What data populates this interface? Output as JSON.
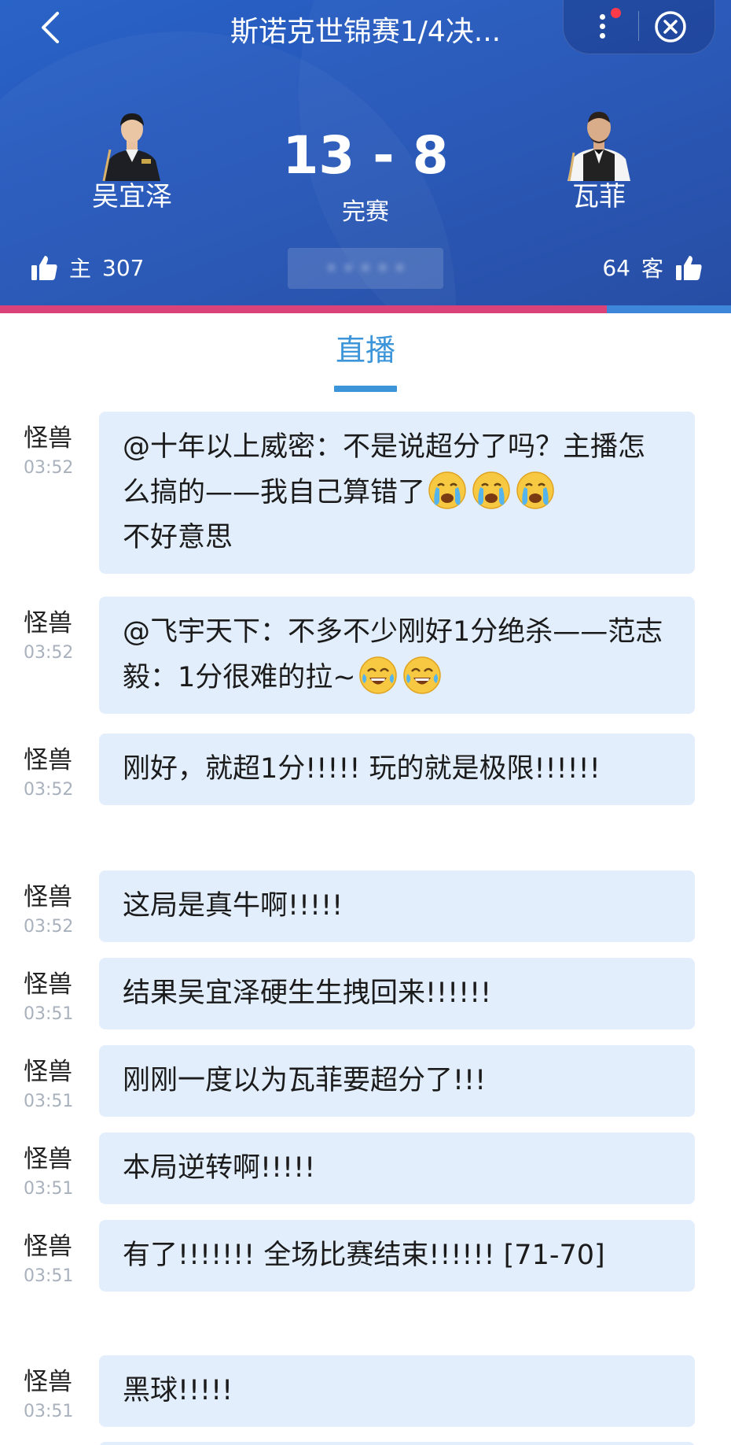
{
  "header": {
    "title": "斯诺克世锦赛1/4决...",
    "score": "13 - 8",
    "status": "完赛",
    "home_player": "吴宜泽",
    "away_player": "瓦菲",
    "home_label": "主",
    "home_votes": "307",
    "away_label": "客",
    "away_votes": "64",
    "home_vote_share": 0.83,
    "colors": {
      "home_bar": "#d9437a",
      "away_bar": "#3e86d9",
      "header_bg": "#2556b9"
    }
  },
  "icons": {
    "back": "chevron-left-icon",
    "more": "more-vertical-icon",
    "close": "close-circle-icon",
    "like": "thumbs-up-icon"
  },
  "tabs": {
    "live": "直播"
  },
  "feed": [
    {
      "author": "怪兽",
      "time": "03:52",
      "parts": [
        "@十年以上威密：不是说超分了吗？主播怎么搞的——我自己算错了",
        "[cry-emoji]",
        "[cry-emoji]",
        "[cry-emoji]",
        "不好意思"
      ]
    },
    {
      "author": "怪兽",
      "time": "03:52",
      "parts": [
        "@飞宇天下：不多不少刚好1分绝杀——范志毅：1分很难的拉~",
        "[laugh-emoji]",
        "[laugh-emoji]"
      ]
    },
    {
      "author": "怪兽",
      "time": "03:52",
      "parts": [
        "刚好，就超1分!!!!!  玩的就是极限!!!!!!"
      ]
    },
    {
      "author": "怪兽",
      "time": "03:52",
      "parts": [
        "这局是真牛啊!!!!!"
      ]
    },
    {
      "author": "怪兽",
      "time": "03:51",
      "parts": [
        "结果吴宜泽硬生生拽回来!!!!!!"
      ]
    },
    {
      "author": "怪兽",
      "time": "03:51",
      "parts": [
        "刚刚一度以为瓦菲要超分了!!!"
      ]
    },
    {
      "author": "怪兽",
      "time": "03:51",
      "parts": [
        "本局逆转啊!!!!!"
      ]
    },
    {
      "author": "怪兽",
      "time": "03:51",
      "parts": [
        "有了!!!!!!!  全场比赛结束!!!!!!  [71-70]"
      ]
    },
    {
      "author": "怪兽",
      "time": "03:51",
      "parts": [
        "黑球!!!!!"
      ]
    }
  ]
}
